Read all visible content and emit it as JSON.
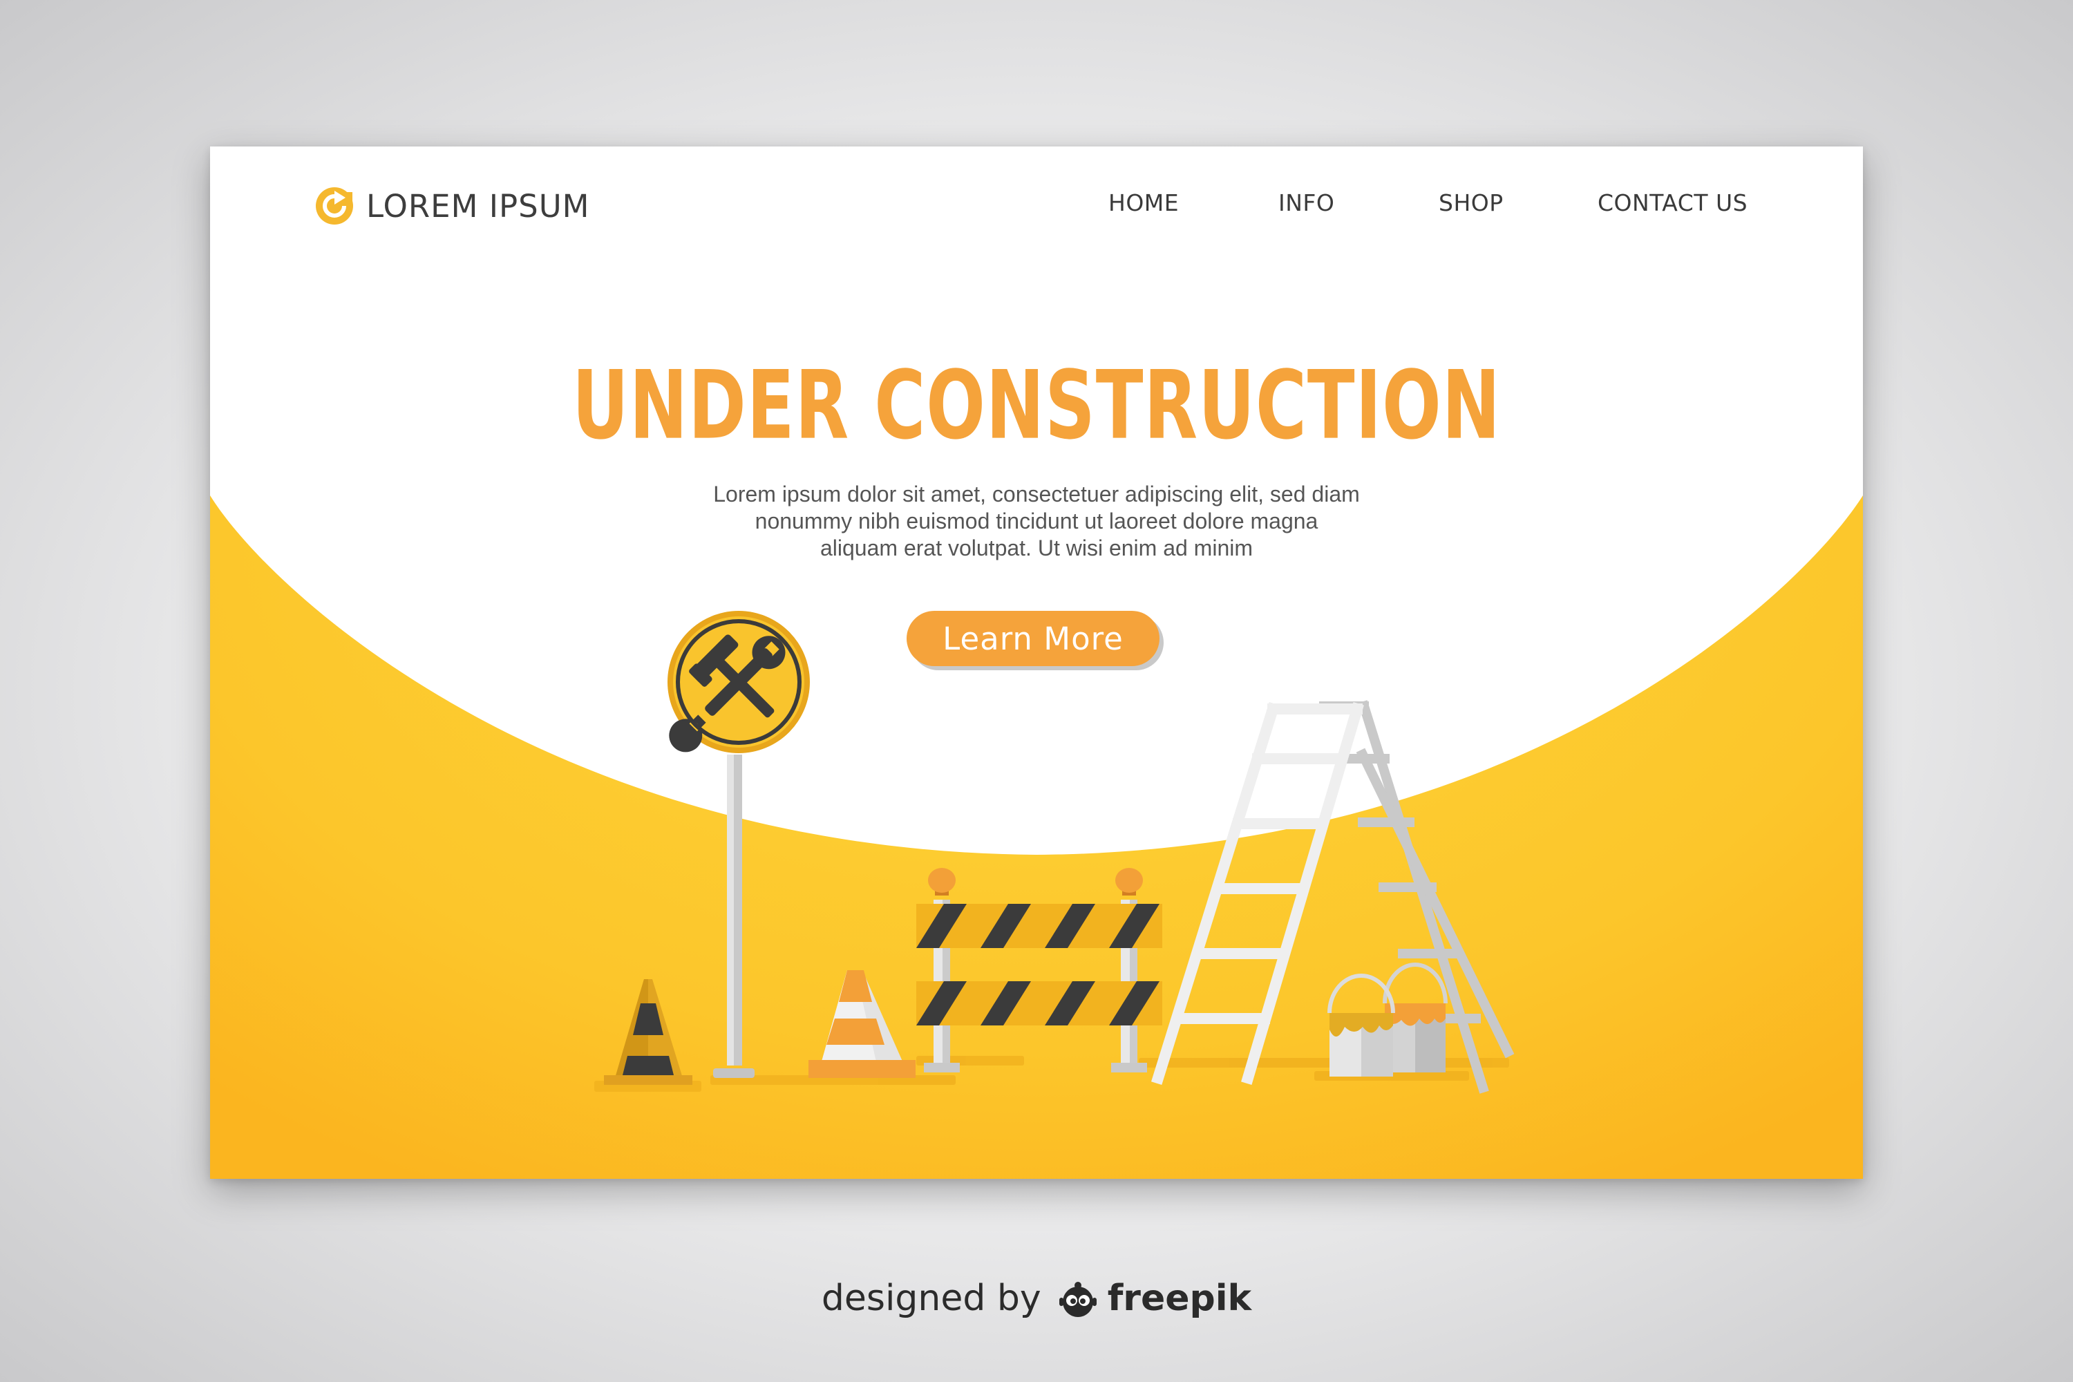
{
  "brand": {
    "name": "LOREM IPSUM",
    "logo_icon": "circular-arrow-logo-icon"
  },
  "nav": {
    "items": [
      {
        "label": "HOME"
      },
      {
        "label": "INFO"
      },
      {
        "label": "SHOP"
      },
      {
        "label": "CONTACT US"
      }
    ]
  },
  "hero": {
    "title": "UNDER CONSTRUCTION",
    "description_lines": [
      "Lorem ipsum dolor sit amet, consectetuer adipiscing elit, sed diam",
      "nonummy nibh euismod tincidunt ut laoreet dolore magna",
      "aliquam erat volutpat. Ut wisi enim ad minim"
    ],
    "cta_label": "Learn More"
  },
  "illustration": {
    "items": [
      "traffic-cone-icon",
      "tools-sign-icon",
      "road-barrier-icon",
      "ladder-icon",
      "paint-bucket-icon"
    ]
  },
  "credit": {
    "prefix": "designed by",
    "brand": "freepik",
    "icon": "freepik-mascot-icon"
  },
  "colors": {
    "accent_orange": "#f5a33b",
    "yellow": "#fcc72c",
    "dark": "#3a3a3a",
    "text_gray": "#555555"
  }
}
